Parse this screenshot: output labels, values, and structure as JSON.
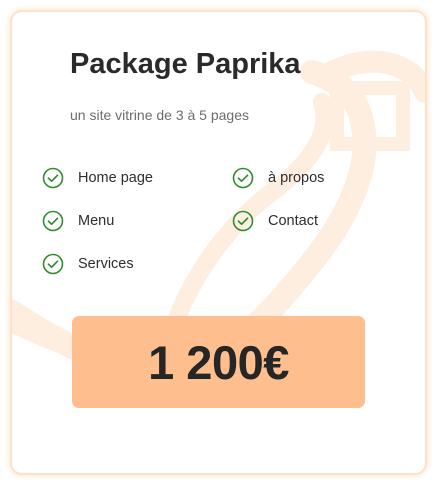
{
  "card": {
    "title": "Package Paprika",
    "subtitle": "un site vitrine de 3 à 5 pages",
    "features": [
      {
        "label": "Home page",
        "icon": "check-circle-icon"
      },
      {
        "label": "à propos",
        "icon": "check-circle-icon"
      },
      {
        "label": "Menu",
        "icon": "check-circle-icon"
      },
      {
        "label": "Contact",
        "icon": "check-circle-icon"
      },
      {
        "label": "Services",
        "icon": "check-circle-icon"
      }
    ],
    "price": "1 200€"
  },
  "colors": {
    "accent": "#ffbe8d",
    "check": "#2e8b2e",
    "decoration": "#fdeee0",
    "title": "#2a2a2a"
  }
}
